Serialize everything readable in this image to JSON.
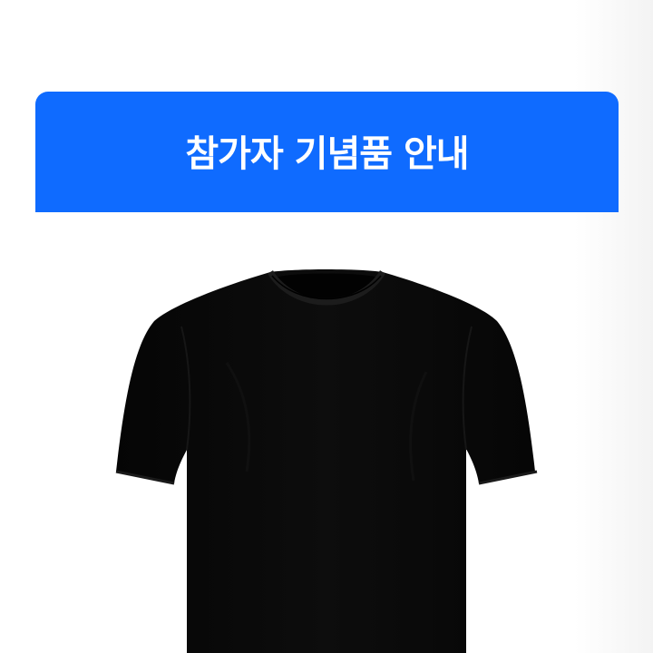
{
  "banner": {
    "title": "참가자 기념품 안내",
    "color": "#0f6bff",
    "text_color": "#ffffff"
  },
  "product": {
    "image": "black-tshirt",
    "color": "#070707"
  }
}
